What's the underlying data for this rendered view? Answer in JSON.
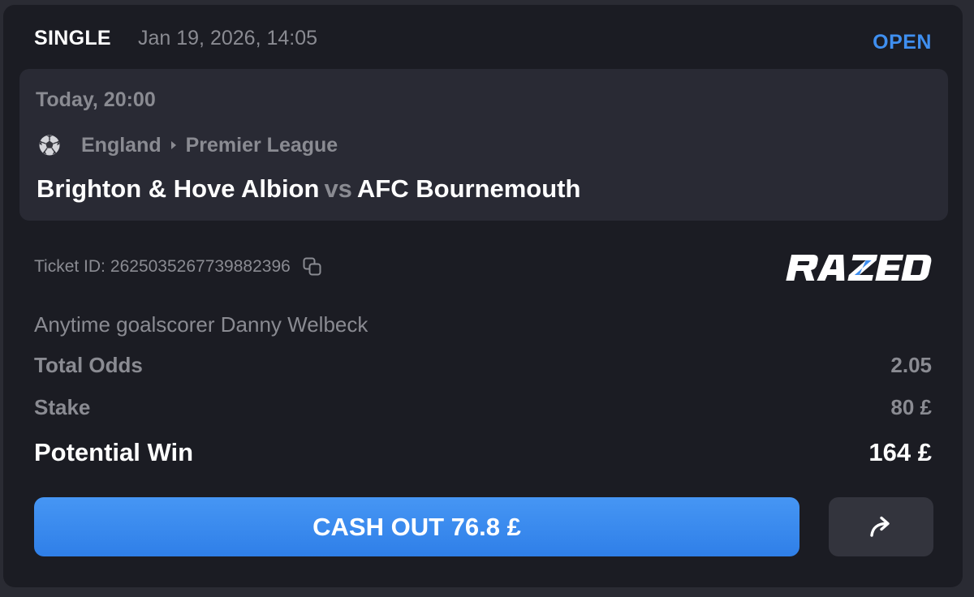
{
  "bet": {
    "type": "SINGLE",
    "placed_at": "Jan 19, 2026, 14:05",
    "status": "OPEN"
  },
  "event": {
    "start_time": "Today, 20:00",
    "sport_icon": "soccer-ball-icon",
    "country": "England",
    "league": "Premier League",
    "home_team": "Brighton & Hove Albion",
    "vs_label": "vs",
    "away_team": "AFC Bournemouth"
  },
  "ticket": {
    "label": "Ticket ID:",
    "id": "2625035267739882396",
    "copy_icon": "copy-icon"
  },
  "brand": {
    "logo_text": "RAZED",
    "accent_color": "#3f8ff0"
  },
  "selection": "Anytime goalscorer Danny Welbeck",
  "details": {
    "odds_label": "Total Odds",
    "odds_value": "2.05",
    "stake_label": "Stake",
    "stake_value": "80 £",
    "win_label": "Potential Win",
    "win_value": "164 £"
  },
  "actions": {
    "cashout_label": "CASH OUT 76.8 £",
    "share_icon": "share-arrow-icon"
  },
  "colors": {
    "background": "#1b1c23",
    "panel": "#292a34",
    "accent": "#3f8ff0",
    "muted_text": "#8a8b92"
  }
}
